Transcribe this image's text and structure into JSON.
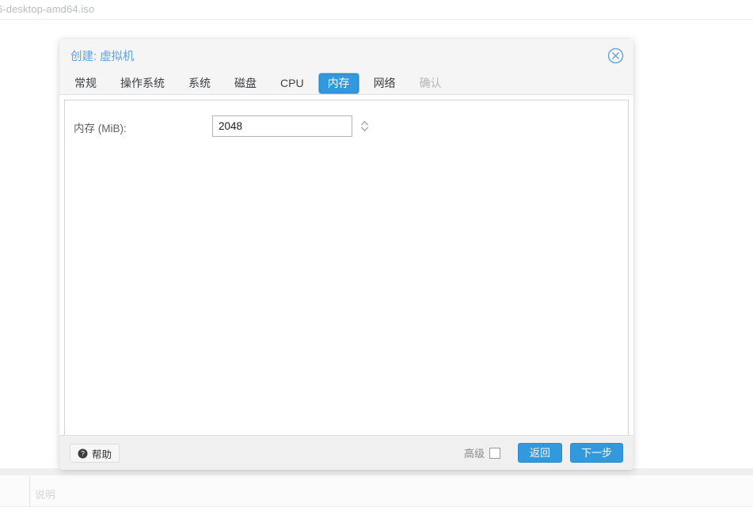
{
  "background": {
    "top_text": "6-desktop-amd64.iso",
    "bottom_panel_label": "说明"
  },
  "dialog": {
    "title": "创建: 虚拟机",
    "close_icon": "close-circle-icon",
    "tabs": [
      {
        "label": "常规",
        "state": "normal"
      },
      {
        "label": "操作系统",
        "state": "normal"
      },
      {
        "label": "系统",
        "state": "normal"
      },
      {
        "label": "磁盘",
        "state": "normal"
      },
      {
        "label": "CPU",
        "state": "normal"
      },
      {
        "label": "内存",
        "state": "active"
      },
      {
        "label": "网络",
        "state": "normal"
      },
      {
        "label": "确认",
        "state": "disabled"
      }
    ],
    "form": {
      "memory_label": "内存 (MiB):",
      "memory_value": "2048",
      "memory_placeholder": "2048"
    },
    "footer": {
      "help_label": "帮助",
      "help_icon": "question-mark-icon",
      "advanced_label": "高级",
      "advanced_checked": false,
      "back_label": "返回",
      "next_label": "下一步"
    }
  },
  "colors": {
    "accent": "#3399dd",
    "title": "#5fa2dd",
    "header_bg": "#f5f5f5",
    "footer_bg": "#f0f0f0"
  }
}
